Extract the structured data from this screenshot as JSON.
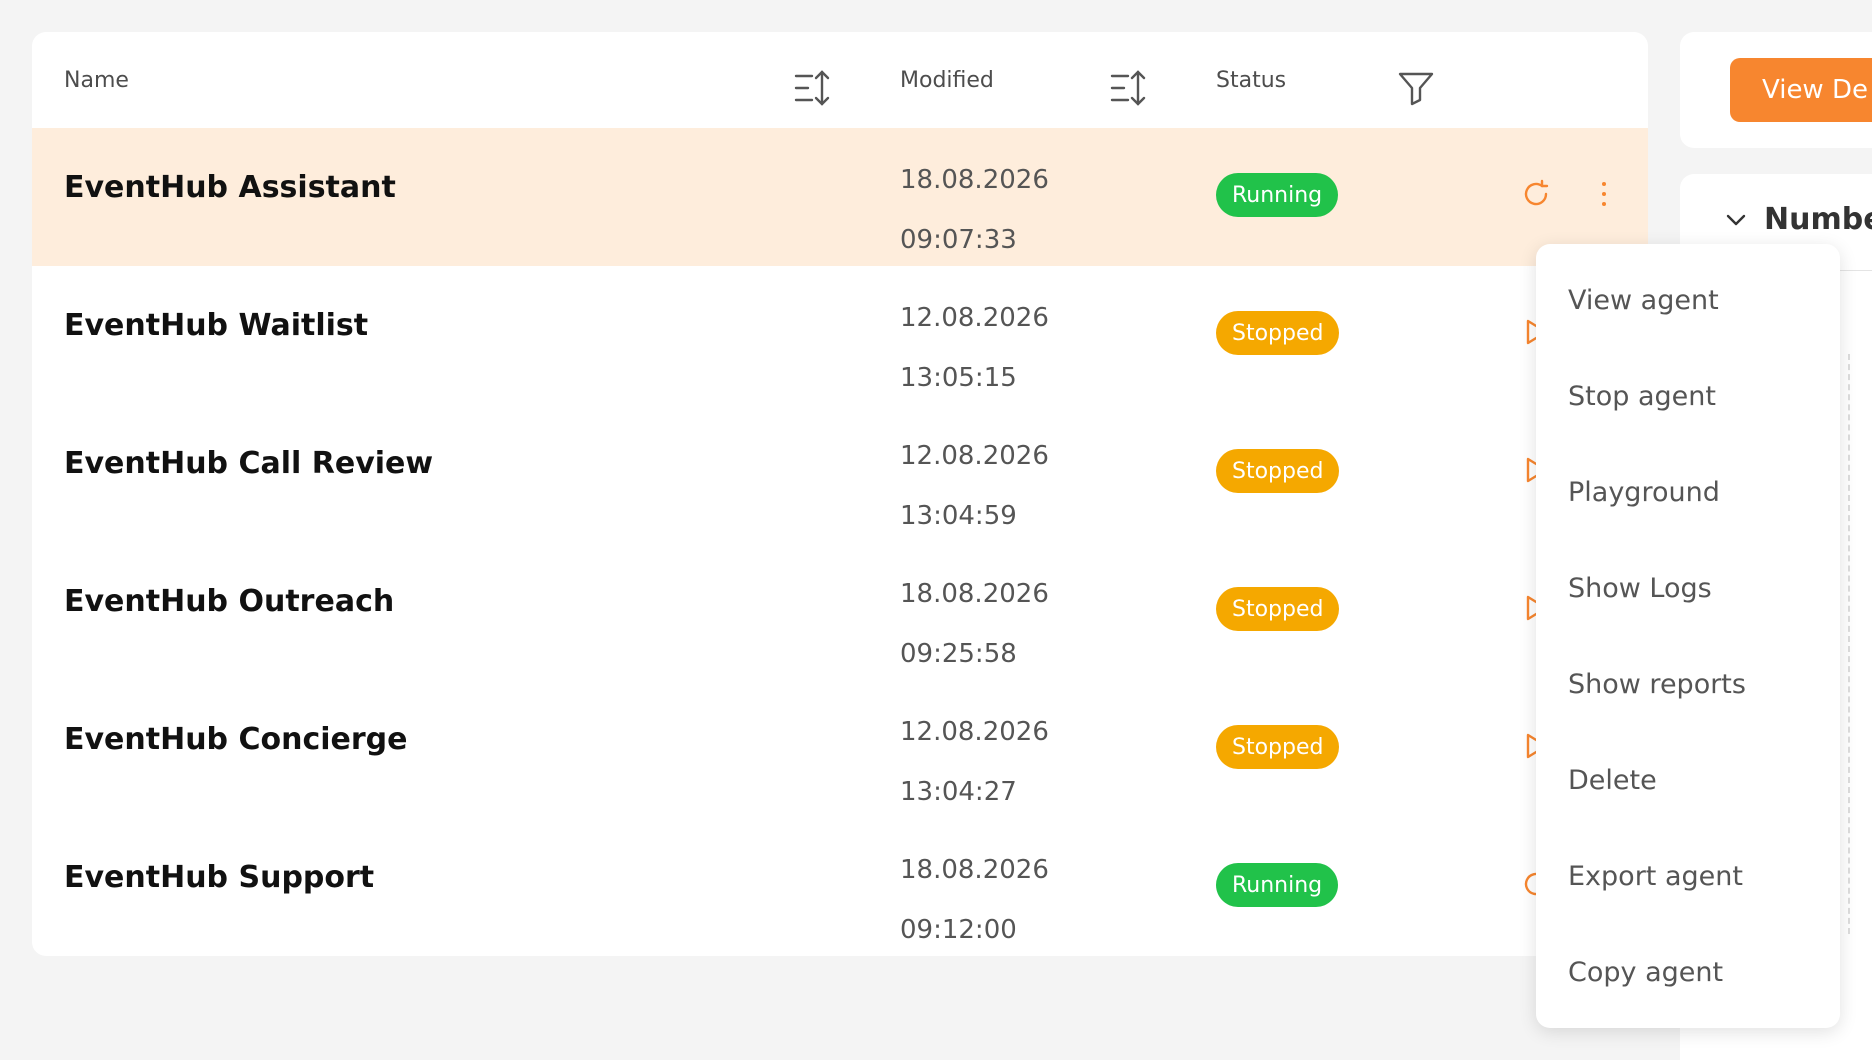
{
  "table": {
    "headers": {
      "name": "Name",
      "modified": "Modified",
      "status": "Status"
    },
    "rows": [
      {
        "name": "EventHub Assistant",
        "date": "18.08.2026",
        "time": "09:07:33",
        "status": "Running",
        "action": "restart-icon"
      },
      {
        "name": "EventHub Waitlist",
        "date": "12.08.2026",
        "time": "13:05:15",
        "status": "Stopped",
        "action": "play-icon"
      },
      {
        "name": "EventHub Call Review",
        "date": "12.08.2026",
        "time": "13:04:59",
        "status": "Stopped",
        "action": "play-icon"
      },
      {
        "name": "EventHub Outreach",
        "date": "18.08.2026",
        "time": "09:25:58",
        "status": "Stopped",
        "action": "play-icon"
      },
      {
        "name": "EventHub Concierge",
        "date": "12.08.2026",
        "time": "13:04:27",
        "status": "Stopped",
        "action": "play-icon"
      },
      {
        "name": "EventHub Support",
        "date": "18.08.2026",
        "time": "09:12:00",
        "status": "Running",
        "action": "restart-icon"
      }
    ]
  },
  "side": {
    "view_button": "View De",
    "section_title": "Number"
  },
  "menu": {
    "items": [
      "View agent",
      "Stop agent",
      "Playground",
      "Show Logs",
      "Show reports",
      "Delete",
      "Export agent",
      "Copy agent"
    ]
  },
  "colors": {
    "accent": "#f7862f",
    "running": "#21c24a",
    "stopped": "#f5a800",
    "highlight_row": "#feeddc"
  }
}
